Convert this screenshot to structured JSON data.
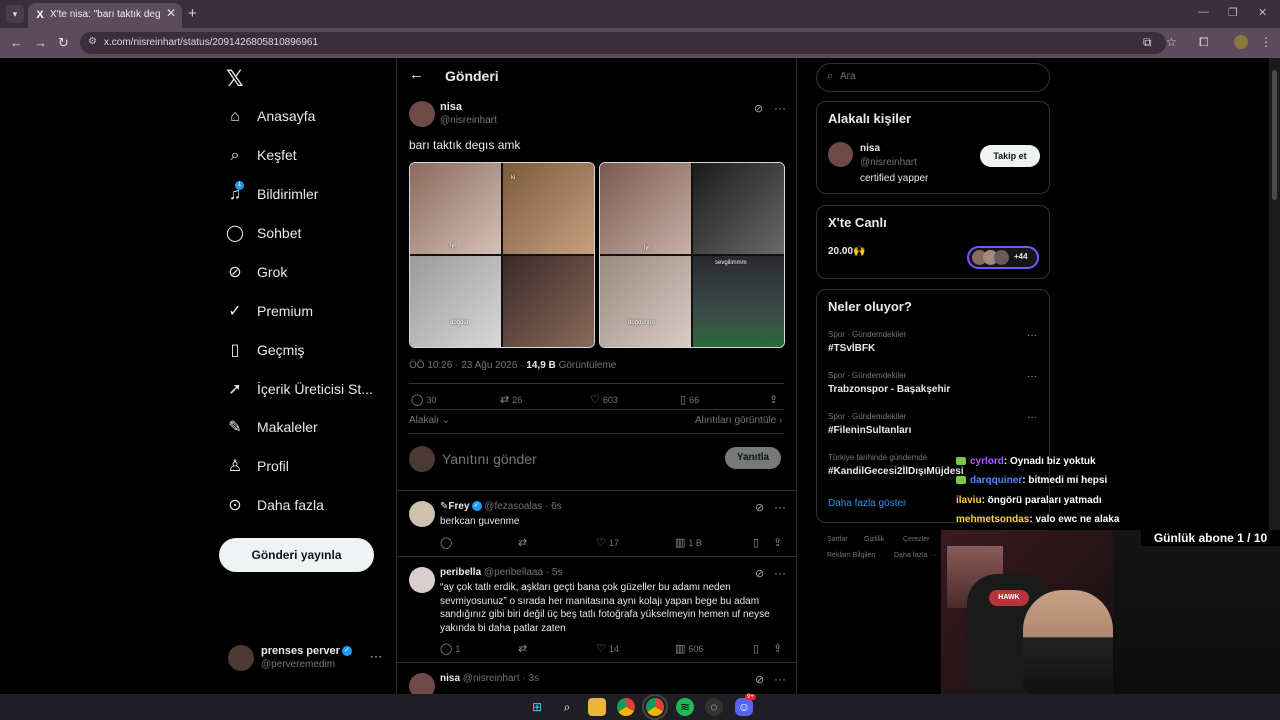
{
  "browser": {
    "tab_title": "X'te nisa: \"barı taktık degıs amk\" / X",
    "tab_favicon": "X",
    "url": "x.com/nisreinhart/status/2091426805810896961"
  },
  "nav": {
    "items": [
      {
        "label": "Anasayfa",
        "icon": "home-icon"
      },
      {
        "label": "Keşfet",
        "icon": "search-icon"
      },
      {
        "label": "Bildirimler",
        "icon": "bell-icon",
        "badge": "1"
      },
      {
        "label": "Sohbet",
        "icon": "chat-icon"
      },
      {
        "label": "Grok",
        "icon": "grok-icon"
      },
      {
        "label": "Premium",
        "icon": "premium-icon"
      },
      {
        "label": "Geçmiş",
        "icon": "bookmark-icon"
      },
      {
        "label": "İçerik Üreticisi St...",
        "icon": "rocket-icon"
      },
      {
        "label": "Makaleler",
        "icon": "article-icon"
      },
      {
        "label": "Profil",
        "icon": "profile-icon"
      },
      {
        "label": "Daha fazla",
        "icon": "more-circle-icon"
      }
    ],
    "post_button": "Gönderi yayınla",
    "account": {
      "name": "prenses perver",
      "handle": "@perveremedim"
    }
  },
  "main": {
    "header_title": "Gönderi",
    "post": {
      "author_name": "nisa",
      "author_handle": "@nisreinhart",
      "text": "barı taktık degıs amk",
      "left_captions": [
        "iyi",
        "ki",
        "doğdun"
      ],
      "right_captions": [
        "iyi",
        "sevgilimmm",
        "doğdunnn"
      ],
      "time": "ÖÖ 10:26 · 23 Ağu 2026 ·",
      "views": "14,9 B",
      "views_label": "Görüntüleme",
      "replies": "30",
      "reposts": "26",
      "likes": "603",
      "bookmarks": "66"
    },
    "sort_label": "Alakalı",
    "quotes_label": "Alıntıları görüntüle",
    "reply_placeholder": "Yanıtını gönder",
    "reply_button": "Yanıtla",
    "replies": [
      {
        "name": "Frey",
        "handle": "@fezasoalas · 6s",
        "text": "berkcan guvenme",
        "likes": "17",
        "views": "1 B"
      },
      {
        "name": "peribella",
        "handle": "@peribellaaa · 5s",
        "text": "“ay çok tatlı erdik, aşkları geçti bana çok güzeller bu adamı neden sevmiyosunuz” o sırada her manitasına aynı kolajı yapan bege bu adam sandığınız gibi biri değil üç beş tatlı fotoğrafa yükselmeyin hemen uf neyse yakında bi daha patlar zaten",
        "replies": "1",
        "likes": "14",
        "views": "606"
      },
      {
        "name": "nisa",
        "handle": "@nisreinhart · 3s"
      }
    ]
  },
  "right": {
    "search_placeholder": "Ara",
    "related": {
      "title": "Alakalı kişiler",
      "name": "nisa",
      "handle": "@nisreinhart",
      "bio": "certified yapper",
      "follow": "Takip et"
    },
    "live": {
      "title": "X'te Canlı",
      "label": "20.00🙌",
      "count": "+44"
    },
    "trends": {
      "title": "Neler oluyor?",
      "items": [
        {
          "category": "Spor · Gündemdekiler",
          "name": "#TSvİBFK"
        },
        {
          "category": "Spor · Gündemdekiler",
          "name": "Trabzonspor - Başakşehir"
        },
        {
          "category": "Spor · Gündemdekiler",
          "name": "#FileninSultanları"
        },
        {
          "category": "Türkiye tarihinde gündemde",
          "name": "#KandilGecesi2İlDışıMüjdesi"
        }
      ],
      "show_more": "Daha fazla göster"
    },
    "footer": [
      "Şartlar",
      "Gizlilik",
      "Çerezler",
      "Reklam Bilgileri",
      "Daha fazla ···"
    ]
  },
  "overlay": {
    "chat": [
      {
        "user": "cyrlord",
        "color": "#b05cff",
        "text": ": Oynadı biz yoktuk"
      },
      {
        "user": "darqquiner",
        "color": "#4a8cff",
        "text": ": bitmedi mi hepsi"
      },
      {
        "user": "ilaviu",
        "color": "#ffd04a",
        "text": ": öngörü paraları yatmadı"
      },
      {
        "user": "mehmetsondas",
        "color": "#ffd04a",
        "text": ": valo ewc ne alaka"
      }
    ],
    "sub_counter": "Günlük abone 1 / 10",
    "chair_brand": "HAWK"
  },
  "taskbar": {
    "icons": [
      "windows-start-icon",
      "search-icon",
      "file-explorer-icon",
      "chrome-icon",
      "chrome-profile-icon",
      "spotify-icon",
      "app-icon",
      "discord-icon"
    ],
    "discord_badge": "9+"
  }
}
